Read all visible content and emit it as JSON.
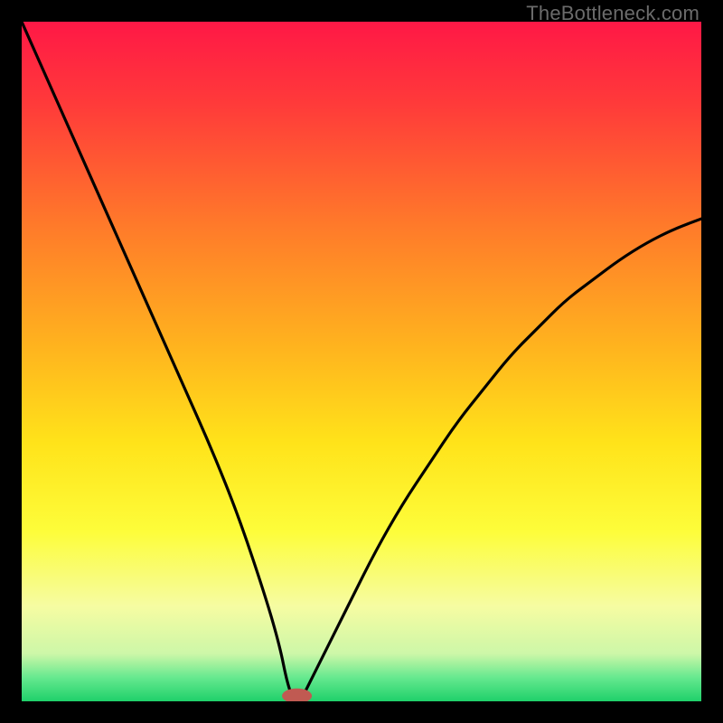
{
  "watermark": "TheBottleneck.com",
  "chart_data": {
    "type": "line",
    "title": "",
    "xlabel": "",
    "ylabel": "",
    "xlim": [
      0,
      100
    ],
    "ylim": [
      0,
      100
    ],
    "grid": false,
    "legend": false,
    "background_gradient": {
      "stops": [
        {
          "offset": 0.0,
          "color": "#ff1846"
        },
        {
          "offset": 0.12,
          "color": "#ff3a3a"
        },
        {
          "offset": 0.3,
          "color": "#ff7a2a"
        },
        {
          "offset": 0.48,
          "color": "#ffb41e"
        },
        {
          "offset": 0.62,
          "color": "#ffe31a"
        },
        {
          "offset": 0.75,
          "color": "#fdfd3a"
        },
        {
          "offset": 0.86,
          "color": "#f6fca2"
        },
        {
          "offset": 0.93,
          "color": "#cdf7a8"
        },
        {
          "offset": 0.965,
          "color": "#66e98f"
        },
        {
          "offset": 1.0,
          "color": "#1fd06a"
        }
      ]
    },
    "curve": {
      "description": "V-shaped bottleneck curve, minimum near x≈40",
      "x": [
        0,
        4,
        8,
        12,
        16,
        20,
        24,
        28,
        32,
        36,
        38,
        39,
        40,
        41,
        42,
        44,
        48,
        52,
        56,
        60,
        64,
        68,
        72,
        76,
        80,
        84,
        88,
        92,
        96,
        100
      ],
      "y": [
        100,
        91,
        82,
        73,
        64,
        55,
        46,
        37,
        27,
        15,
        8,
        3,
        0,
        0,
        2,
        6,
        14,
        22,
        29,
        35,
        41,
        46,
        51,
        55,
        59,
        62,
        65,
        67.5,
        69.5,
        71
      ]
    },
    "marker": {
      "x": 40.5,
      "y": 0.8,
      "rx": 2.2,
      "ry": 1.1,
      "color": "#c05a52"
    }
  }
}
